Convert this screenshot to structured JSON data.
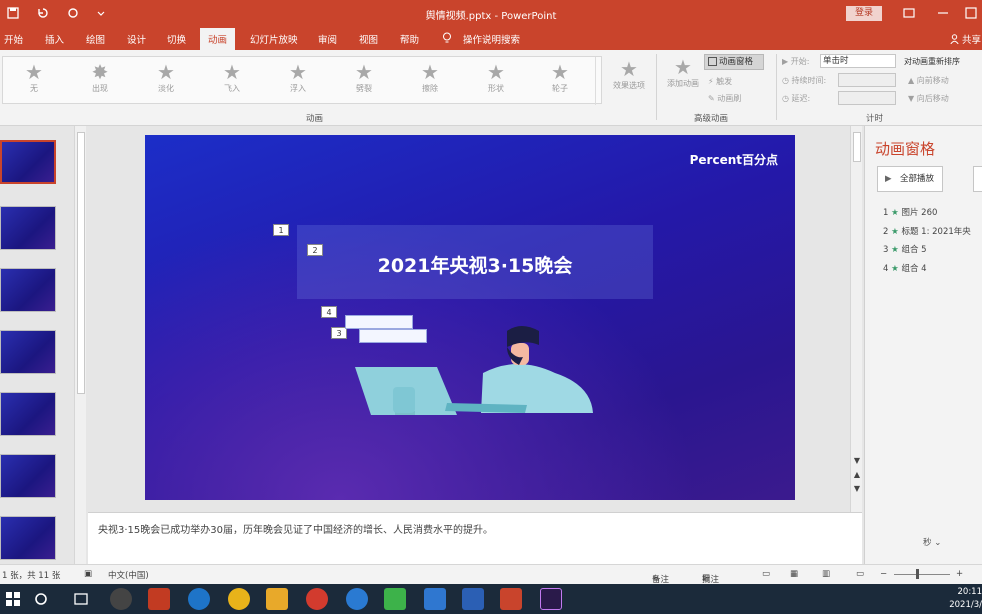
{
  "window": {
    "title": "舆情视频.pptx - PowerPoint",
    "login_label": "登录",
    "share_label": "共享"
  },
  "tabs": [
    {
      "label": "开始"
    },
    {
      "label": "插入"
    },
    {
      "label": "绘图"
    },
    {
      "label": "设计"
    },
    {
      "label": "切换"
    },
    {
      "label": "动画"
    },
    {
      "label": "幻灯片放映"
    },
    {
      "label": "审阅"
    },
    {
      "label": "视图"
    },
    {
      "label": "帮助"
    },
    {
      "label": "操作说明搜索"
    }
  ],
  "ribbon": {
    "gallery": [
      {
        "label": "无"
      },
      {
        "label": "出现"
      },
      {
        "label": "淡化"
      },
      {
        "label": "飞入"
      },
      {
        "label": "浮入"
      },
      {
        "label": "劈裂"
      },
      {
        "label": "擦除"
      },
      {
        "label": "形状"
      },
      {
        "label": "轮子"
      }
    ],
    "effect_options_label": "效果选项",
    "group_animation_label": "动画",
    "add_animation_label": "添加动画",
    "animation_pane_label": "动画窗格",
    "trigger_label": "触发",
    "animation_painter_label": "动画刷",
    "group_advanced_label": "高级动画",
    "start_label": "开始:",
    "start_value": "单击时",
    "duration_label": "持续时间:",
    "delay_label": "延迟:",
    "group_timing_label": "计时",
    "reorder_label": "对动画重新排序",
    "move_earlier_label": "向前移动",
    "move_later_label": "向后移动"
  },
  "slide": {
    "brand": "Percent百分点",
    "title": "2021年央视3·15晚会",
    "markers": [
      "1",
      "2",
      "4",
      "3"
    ]
  },
  "notes": {
    "text": "央视3·15晚会已成功举办30届，历年晚会见证了中国经济的增长、人民消费水平的提升。"
  },
  "anim_pane": {
    "title": "动画窗格",
    "play_all_label": "全部播放",
    "items": [
      {
        "num": "1",
        "label": "图片 260"
      },
      {
        "num": "2",
        "label": "标题 1: 2021年央"
      },
      {
        "num": "3",
        "label": "组合 5"
      },
      {
        "num": "4",
        "label": "组合 4"
      }
    ],
    "seconds_label": "秒"
  },
  "status": {
    "slide_info": "1 张，共 11 张",
    "language": "中文(中国)",
    "notes_label": "备注",
    "comments_label": "批注"
  },
  "taskbar": {
    "time": "20:11",
    "date": "2021/3/"
  },
  "colors": {
    "accent": "#c9442c",
    "slide_bg": "#2418a8"
  }
}
